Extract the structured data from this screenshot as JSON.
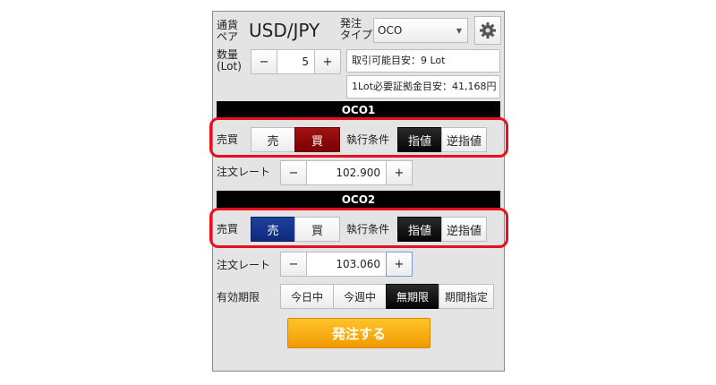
{
  "header": {
    "pair_label": "通貨ペア",
    "pair_label_l1": "通貨",
    "pair_label_l2": "ペア",
    "pair_value": "USD/JPY",
    "order_type_label_l1": "発注",
    "order_type_label_l2": "タイプ",
    "order_type_value": "OCO",
    "settings_icon": "gear-icon"
  },
  "quantity": {
    "label_l1": "数量",
    "label_l2": "(Lot)",
    "minus": "−",
    "value": "5",
    "plus": "+",
    "available_info": "取引可能目安：9 Lot",
    "margin_info": "1Lot必要証拠金目安：41,168円"
  },
  "oco1": {
    "title": "OCO1",
    "side_label": "売買",
    "sell": "売",
    "buy": "買",
    "exec_label": "執行条件",
    "limit": "指値",
    "stop": "逆指値",
    "rate_label": "注文レート",
    "rate_minus": "−",
    "rate_value": "102.900",
    "rate_plus": "+"
  },
  "oco2": {
    "title": "OCO2",
    "side_label": "売買",
    "sell": "売",
    "buy": "買",
    "exec_label": "執行条件",
    "limit": "指値",
    "stop": "逆指値",
    "rate_label": "注文レート",
    "rate_minus": "−",
    "rate_value": "103.060",
    "rate_plus": "+"
  },
  "expiry": {
    "label": "有効期限",
    "options": [
      "今日中",
      "今週中",
      "無期限",
      "期間指定"
    ],
    "selected": "無期限"
  },
  "submit": {
    "label": "発注する"
  },
  "colors": {
    "highlight": "#e8101e",
    "buy_selected": "#8b0000",
    "sell_selected": "#153489",
    "submit": "#f5a000"
  }
}
